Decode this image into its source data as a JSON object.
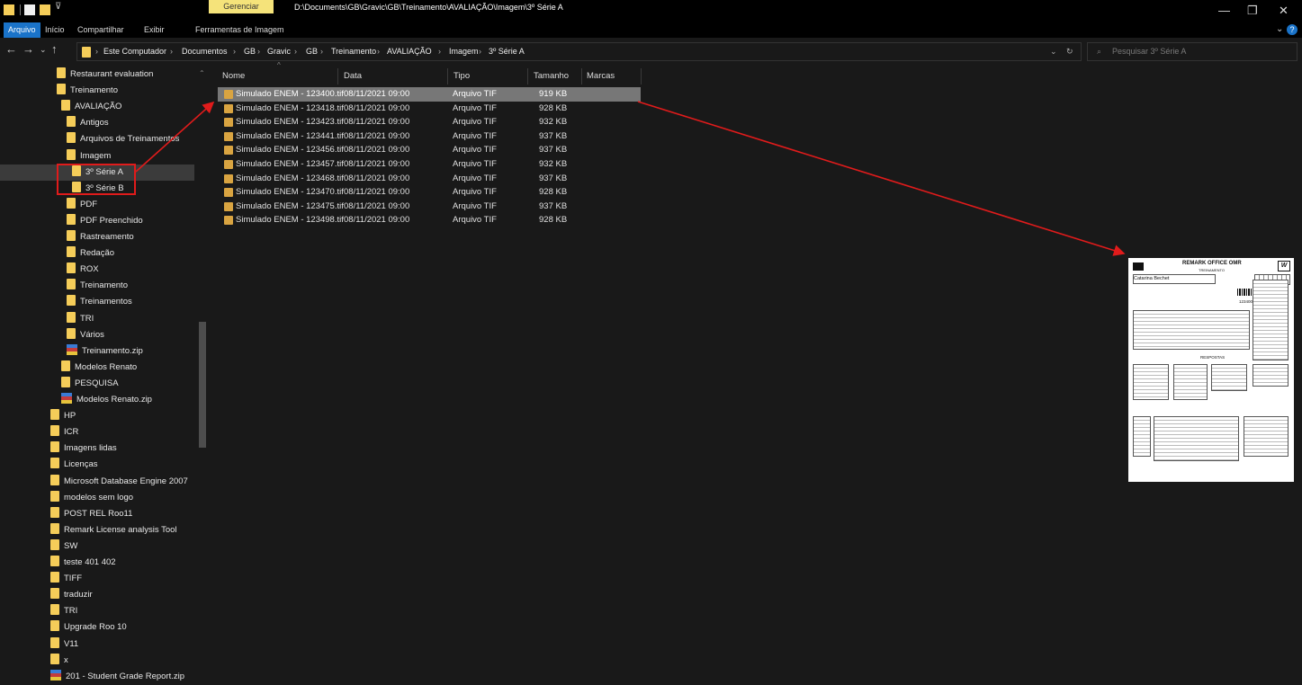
{
  "titlebar": {
    "manage_tab": "Gerenciar",
    "path_title": "D:\\Documents\\GB\\Gravic\\GB\\Treinamento\\AVALIAÇÃO\\Imagem\\3º Série A",
    "minimize": "—",
    "maximize": "❐",
    "close": "✕"
  },
  "ribbon": {
    "tabs": [
      "Arquivo",
      "Início",
      "Compartilhar",
      "Exibir",
      "Ferramentas de Imagem"
    ]
  },
  "address": {
    "crumbs": [
      "Este Computador",
      "Documentos",
      "GB",
      "Gravic",
      "GB",
      "Treinamento",
      "AVALIAÇÃO",
      "Imagem",
      "3º Série A"
    ],
    "separator": "›",
    "search_placeholder": "Pesquisar 3º Série A"
  },
  "sidebar": {
    "items": [
      {
        "label": "Restaurant evaluation",
        "type": "folder"
      },
      {
        "label": "Treinamento",
        "type": "folder"
      },
      {
        "label": "AVALIAÇÃO",
        "type": "folder"
      },
      {
        "label": "Antigos",
        "type": "folder"
      },
      {
        "label": "Arquivos de Treinamentos",
        "type": "folder"
      },
      {
        "label": "Imagem",
        "type": "folder"
      },
      {
        "label": "3º Série A",
        "type": "folder"
      },
      {
        "label": "3º Série B",
        "type": "folder"
      },
      {
        "label": "PDF",
        "type": "folder"
      },
      {
        "label": "PDF Preenchido",
        "type": "folder"
      },
      {
        "label": "Rastreamento",
        "type": "folder"
      },
      {
        "label": "Redação",
        "type": "folder"
      },
      {
        "label": "ROX",
        "type": "folder"
      },
      {
        "label": "Treinamento",
        "type": "folder"
      },
      {
        "label": "Treinamentos",
        "type": "folder"
      },
      {
        "label": "TRI",
        "type": "folder"
      },
      {
        "label": "Vários",
        "type": "folder"
      },
      {
        "label": "Treinamento.zip",
        "type": "zip"
      },
      {
        "label": "Modelos Renato",
        "type": "folder"
      },
      {
        "label": "PESQUISA",
        "type": "folder"
      },
      {
        "label": "Modelos Renato.zip",
        "type": "zip"
      },
      {
        "label": "HP",
        "type": "folder"
      },
      {
        "label": "ICR",
        "type": "folder"
      },
      {
        "label": "Imagens lidas",
        "type": "folder"
      },
      {
        "label": "Licenças",
        "type": "folder"
      },
      {
        "label": "Microsoft Database Engine 2007",
        "type": "folder"
      },
      {
        "label": "modelos sem logo",
        "type": "folder"
      },
      {
        "label": "POST REL Roo11",
        "type": "folder"
      },
      {
        "label": "Remark License analysis Tool",
        "type": "folder"
      },
      {
        "label": "SW",
        "type": "folder"
      },
      {
        "label": "teste 401 402",
        "type": "folder"
      },
      {
        "label": "TIFF",
        "type": "folder"
      },
      {
        "label": "traduzir",
        "type": "folder"
      },
      {
        "label": "TRI",
        "type": "folder"
      },
      {
        "label": "Upgrade Roo 10",
        "type": "folder"
      },
      {
        "label": "V11",
        "type": "folder"
      },
      {
        "label": "x",
        "type": "folder"
      },
      {
        "label": "201 - Student Grade Report.zip",
        "type": "zip"
      }
    ]
  },
  "filelist": {
    "columns": [
      "Nome",
      "Data",
      "Tipo",
      "Tamanho",
      "Marcas"
    ],
    "rows": [
      {
        "name": "Simulado ENEM - 123400.tif",
        "date": "08/11/2021 09:00",
        "type": "Arquivo TIF",
        "size": "919 KB"
      },
      {
        "name": "Simulado ENEM - 123418.tif",
        "date": "08/11/2021 09:00",
        "type": "Arquivo TIF",
        "size": "928 KB"
      },
      {
        "name": "Simulado ENEM - 123423.tif",
        "date": "08/11/2021 09:00",
        "type": "Arquivo TIF",
        "size": "932 KB"
      },
      {
        "name": "Simulado ENEM - 123441.tif",
        "date": "08/11/2021 09:00",
        "type": "Arquivo TIF",
        "size": "937 KB"
      },
      {
        "name": "Simulado ENEM - 123456.tif",
        "date": "08/11/2021 09:00",
        "type": "Arquivo TIF",
        "size": "937 KB"
      },
      {
        "name": "Simulado ENEM - 123457.tif",
        "date": "08/11/2021 09:00",
        "type": "Arquivo TIF",
        "size": "932 KB"
      },
      {
        "name": "Simulado ENEM - 123468.tif",
        "date": "08/11/2021 09:00",
        "type": "Arquivo TIF",
        "size": "937 KB"
      },
      {
        "name": "Simulado ENEM - 123470.tif",
        "date": "08/11/2021 09:00",
        "type": "Arquivo TIF",
        "size": "928 KB"
      },
      {
        "name": "Simulado ENEM - 123475.tif",
        "date": "08/11/2021 09:00",
        "type": "Arquivo TIF",
        "size": "937 KB"
      },
      {
        "name": "Simulado ENEM - 123498.tif",
        "date": "08/11/2021 09:00",
        "type": "Arquivo TIF",
        "size": "928 KB"
      }
    ]
  },
  "preview": {
    "title": "REMARK OFFICE OMR",
    "subtitle": "TREINAMENTO",
    "student_name": "Catarina Bechet",
    "id_number": "123400",
    "answers_label": "RESPOSTAS"
  },
  "colors": {
    "accent": "#1a73c9",
    "folder": "#f5cd59",
    "annotation": "#e01b1b",
    "manage_tab": "#f5e37a"
  }
}
